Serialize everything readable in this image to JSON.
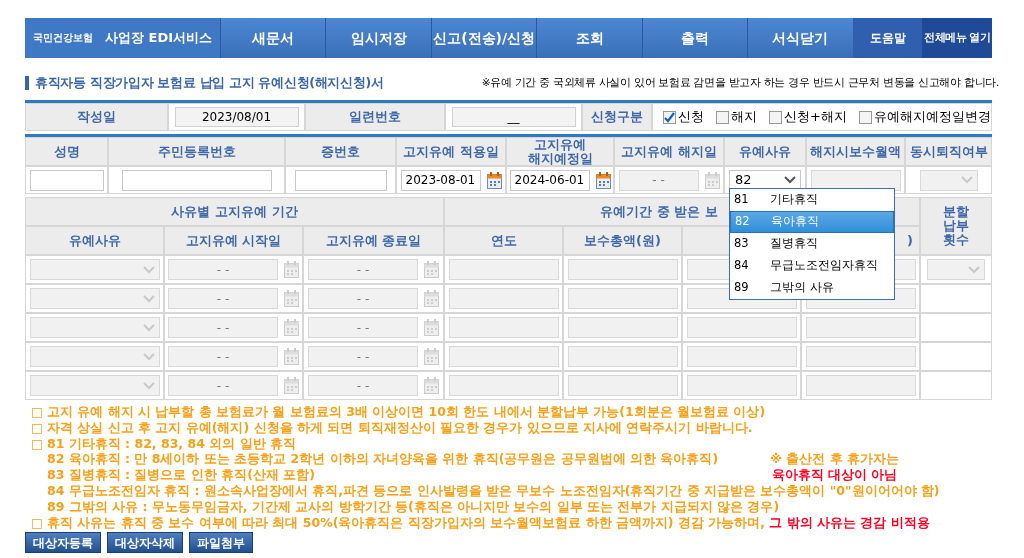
{
  "header": {
    "brand_small": "국민건강보험",
    "brand": "사업장 EDI서비스",
    "menu": [
      {
        "label": "새문서",
        "kind": "main"
      },
      {
        "label": "임시저장",
        "kind": "main"
      },
      {
        "label": "신고(전송)/신청",
        "kind": "main"
      },
      {
        "label": "조회",
        "kind": "main"
      },
      {
        "label": "출력",
        "kind": "main"
      },
      {
        "label": "서식닫기",
        "kind": "main"
      },
      {
        "label": "도움말",
        "kind": "help"
      },
      {
        "label": "전체메뉴 열기",
        "kind": "all"
      }
    ]
  },
  "page_title": "휴직자등 직장가입자 보험료 납입 고지 유예신청(해지신청)서",
  "notice": "※유예 기간 중 국외체류 사실이 있어 보험료 감면을 받고자 하는 경우 반드시 근무처 변동을 신고해야 합니다.",
  "form": {
    "fields": [
      {
        "label": "작성일",
        "value": "2023/08/01"
      },
      {
        "label": "일련번호",
        "value": "__"
      }
    ],
    "request_type": {
      "label": "신청구분",
      "options": [
        {
          "label": "신청",
          "checked": true
        },
        {
          "label": "해지",
          "checked": false
        },
        {
          "label": "신청+해지",
          "checked": false
        },
        {
          "label": "유예해지예정일변경",
          "checked": false
        }
      ]
    }
  },
  "person_table": {
    "columns": [
      "성명",
      "주민등록번호",
      "증번호",
      "고지유예 적용일",
      "고지유예\n해지예정일",
      "고지유예 해지일",
      "유예사유",
      "해지시보수월액",
      "동시퇴직여부"
    ],
    "row": [
      {
        "kind": "text",
        "disabled": false
      },
      {
        "kind": "text",
        "disabled": false
      },
      {
        "kind": "text",
        "disabled": false
      },
      {
        "kind": "date",
        "value": "2023-08-01",
        "disabled": false
      },
      {
        "kind": "date",
        "value": "2024-06-01",
        "disabled": false
      },
      {
        "kind": "date",
        "value": "- -",
        "disabled": true
      },
      {
        "kind": "select",
        "value": "82",
        "disabled": false
      },
      {
        "kind": "text",
        "disabled": true
      },
      {
        "kind": "select",
        "disabled": true
      }
    ]
  },
  "reason_dropdown": {
    "options": [
      {
        "code": "81",
        "label": "기타휴직",
        "selected": false
      },
      {
        "code": "82",
        "label": "육아휴직",
        "selected": true
      },
      {
        "code": "83",
        "label": "질병휴직",
        "selected": false
      },
      {
        "code": "84",
        "label": "무급노조전임자휴직",
        "selected": false
      },
      {
        "code": "89",
        "label": "그밖의 사유",
        "selected": false
      }
    ]
  },
  "period_table": {
    "group_headers": [
      "사유별 고지유예 기간",
      "유예기간 중 받은 보",
      "분할\n납부\n횟수"
    ],
    "columns": [
      "유예사유",
      "고지유예 시작일",
      "고지유예 종료일",
      "연도",
      "보수총액(원)",
      ")"
    ],
    "rows": [
      {
        "cells": [
          {
            "kind": "select",
            "disabled": true
          },
          {
            "kind": "date",
            "value": "- -",
            "disabled": true
          },
          {
            "kind": "date",
            "value": "- -",
            "disabled": true
          },
          {
            "kind": "text",
            "disabled": true
          },
          {
            "kind": "text",
            "disabled": true
          },
          {
            "kind": "text",
            "disabled": true
          },
          {
            "kind": "text",
            "disabled": true
          },
          {
            "kind": "select",
            "disabled": true
          }
        ]
      },
      {
        "cells": [
          {
            "kind": "select",
            "disabled": true
          },
          {
            "kind": "date",
            "value": "- -",
            "disabled": true
          },
          {
            "kind": "date",
            "value": "- -",
            "disabled": true
          },
          {
            "kind": "text",
            "disabled": true
          },
          {
            "kind": "text",
            "disabled": true
          },
          {
            "kind": "text",
            "disabled": true
          },
          {
            "kind": "text",
            "disabled": true
          },
          {
            "kind": "blank"
          }
        ]
      },
      {
        "cells": [
          {
            "kind": "select",
            "disabled": true
          },
          {
            "kind": "date",
            "value": "- -",
            "disabled": true
          },
          {
            "kind": "date",
            "value": "- -",
            "disabled": true
          },
          {
            "kind": "text",
            "disabled": true
          },
          {
            "kind": "text",
            "disabled": true
          },
          {
            "kind": "text",
            "disabled": true
          },
          {
            "kind": "text",
            "disabled": true
          },
          {
            "kind": "blank"
          }
        ]
      },
      {
        "cells": [
          {
            "kind": "select",
            "disabled": true
          },
          {
            "kind": "date",
            "value": "- -",
            "disabled": true
          },
          {
            "kind": "date",
            "value": "- -",
            "disabled": true
          },
          {
            "kind": "text",
            "disabled": true
          },
          {
            "kind": "text",
            "disabled": true
          },
          {
            "kind": "text",
            "disabled": true
          },
          {
            "kind": "text",
            "disabled": true
          },
          {
            "kind": "blank"
          }
        ]
      },
      {
        "cells": [
          {
            "kind": "select",
            "disabled": true
          },
          {
            "kind": "date",
            "value": "- -",
            "disabled": true
          },
          {
            "kind": "date",
            "value": "- -",
            "disabled": true
          },
          {
            "kind": "text",
            "disabled": true
          },
          {
            "kind": "text",
            "disabled": true
          },
          {
            "kind": "text",
            "disabled": true
          },
          {
            "kind": "text",
            "disabled": true
          },
          {
            "kind": "blank"
          }
        ]
      }
    ]
  },
  "notes": [
    {
      "bullet": "□",
      "parts": [
        {
          "text": "고지 유예 해지 시 납부할 총 보험료가 월 보험료의 3배 이상이면 10회 한도 내에서 분할납부 가능(1회분은 월보험료 이상)",
          "emphasis": false
        }
      ]
    },
    {
      "bullet": "□",
      "parts": [
        {
          "text": "자격 상실 신고 후 고지 유예(해지) 신청을 하게 되면 퇴직재정산이 필요한 경우가 있으므로 지사에 연락주시기 바랍니다.",
          "emphasis": false
        }
      ]
    },
    {
      "bullet": "□",
      "parts": [
        {
          "text": "81 기타휴직 : 82, 83, 84 외의 일반 휴직",
          "emphasis": false
        }
      ]
    },
    {
      "parts": [
        {
          "text": "82 육아휴직 : 만 8세이하 또는 초등학교 2학년 이하의 자녀양육을 위한 휴직(공무원은 공무원법에 의한 육아휴직)",
          "emphasis": false
        }
      ],
      "aside": {
        "text": "※ 출산전 후 휴가자는",
        "emphasis": false
      }
    },
    {
      "parts": [
        {
          "text": "83 질병휴직 : 질병으로 인한 휴직(산재 포함)",
          "emphasis": false
        }
      ],
      "aside": {
        "text": "육아휴직 대상이 아님",
        "emphasis": true
      }
    },
    {
      "parts": [
        {
          "text": "84 무급노조전임자 휴직 : 원소속사업장에서 휴직,파견 등으로 인사발령을 받은 무보수 노조전임자(휴직기간 중 지급받은 보수총액이 \"0\"원이어어야 함)",
          "emphasis": false
        }
      ]
    },
    {
      "parts": [
        {
          "text": "89 그밖의 사유 : 무노동무임금자, 기간제 교사의 방학기간 등(휴직은 아니지만 보수의 일부 또는 전부가 지급되지 않은 경우)",
          "emphasis": false
        }
      ]
    },
    {
      "bullet": "□",
      "parts": [
        {
          "text": "휴직 사유는 휴직 중 보수 여부에 따라 최대 50%(육아휴직은 직장가입자의 보수월액보험료 하한 금액까지) 경감 가능하며, ",
          "emphasis": false
        },
        {
          "text": "그 밖의 사유는 경감 비적용",
          "emphasis": true
        }
      ]
    }
  ],
  "buttons": [
    "대상자등록",
    "대상자삭제",
    "파일첨부"
  ]
}
